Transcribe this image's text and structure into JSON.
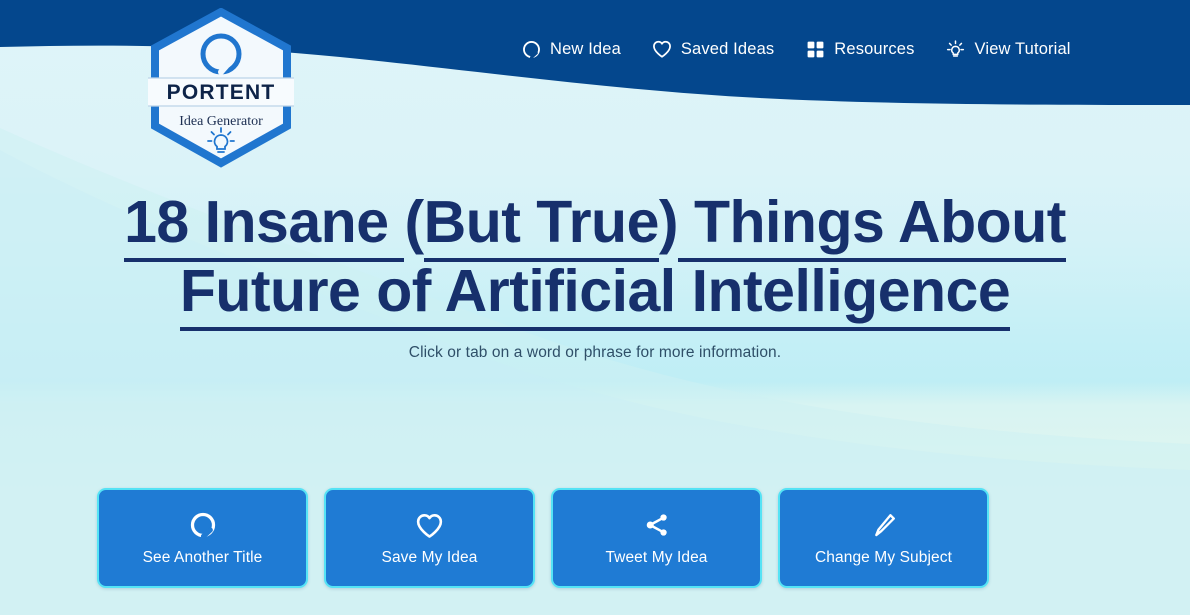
{
  "brand": {
    "name": "PORTENT",
    "tagline": "Idea Generator",
    "logo_icon": "portent-circle-mark",
    "bulb_icon": "lightbulb-icon",
    "colors": {
      "header_blue": "#04478d",
      "logo_blue": "#1f7bd4",
      "title_navy": "#17306c",
      "button_blue": "#1f7bd4",
      "button_border_cyan": "#55e3f5",
      "background_cyan": "#dff4f9"
    }
  },
  "nav": {
    "items": [
      {
        "label": "New Idea",
        "icon": "refresh-circle-icon"
      },
      {
        "label": "Saved Ideas",
        "icon": "heart-icon"
      },
      {
        "label": "Resources",
        "icon": "grid-squares-icon"
      },
      {
        "label": "View Tutorial",
        "icon": "lightbulb-rays-icon"
      }
    ]
  },
  "main": {
    "title_segments": [
      {
        "text": "18 Insane ",
        "underlined": true
      },
      {
        "text": "(",
        "underlined": false
      },
      {
        "text": "But True",
        "underlined": true
      },
      {
        "text": ")",
        "underlined": false
      },
      {
        "text": " Things About Future of Artificial Intelligence",
        "underlined": true
      }
    ],
    "title_plain": "18 Insane (But True) Things About Future of Artificial Intelligence",
    "subtitle": "Click or tab on a word or phrase for more information."
  },
  "actions": {
    "buttons": [
      {
        "label": "See Another Title",
        "icon": "refresh-circle-icon"
      },
      {
        "label": "Save My Idea",
        "icon": "heart-icon"
      },
      {
        "label": "Tweet My Idea",
        "icon": "share-icon"
      },
      {
        "label": "Change My Subject",
        "icon": "pencil-icon"
      }
    ]
  }
}
